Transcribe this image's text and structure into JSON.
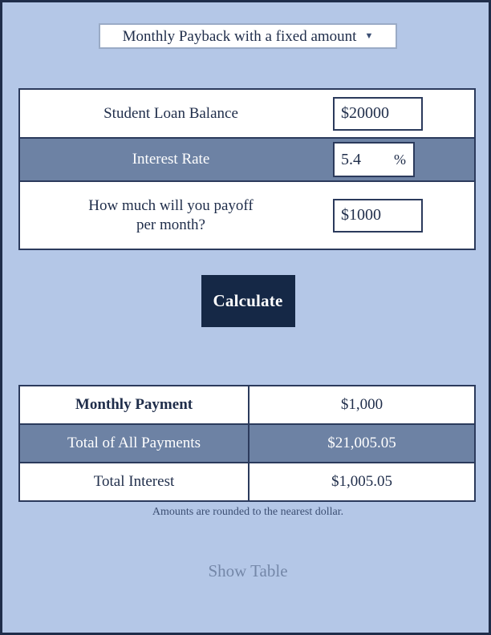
{
  "colors": {
    "page_background": "#b4c7e7",
    "frame_border": "#1f2d4a",
    "panel_border": "#2b3a5c",
    "alt_row": "#6d82a4",
    "button_background": "#152846",
    "text_dark": "#1f2d4a",
    "text_light": "#ffffff",
    "muted_link": "#7487a8"
  },
  "mode_select": {
    "selected": "Monthly Payback with a fixed amount",
    "arrow_icon": "chevron-down-icon",
    "options": [
      "Monthly Payback with a fixed amount"
    ]
  },
  "form": {
    "rows": [
      {
        "label": "Student Loan Balance",
        "value": "$20000",
        "placeholder": "$20000",
        "suffix": ""
      },
      {
        "label": "Interest Rate",
        "value": "5.4",
        "placeholder": "5.4",
        "suffix": "%"
      },
      {
        "label_line1": "How much will you payoff",
        "label_line2": "per month?",
        "value": "$1000",
        "placeholder": "$1000",
        "suffix": ""
      }
    ]
  },
  "actions": {
    "calculate_label": "Calculate"
  },
  "results": {
    "rows": [
      {
        "label": "Monthly Payment",
        "value": "$1,000"
      },
      {
        "label": "Total of All Payments",
        "value": "$21,005.05"
      },
      {
        "label": "Total Interest",
        "value": "$1,005.05"
      }
    ]
  },
  "footnote": "Amounts are rounded to the nearest dollar.",
  "show_table_label": "Show Table"
}
